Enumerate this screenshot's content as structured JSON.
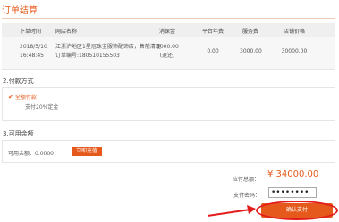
{
  "page_title": "订单结算",
  "order_table": {
    "headers": [
      "下单时间",
      "网店名称",
      "消保金",
      "平台年费",
      "服务费",
      "店铺价格"
    ],
    "row": {
      "date": "2018/5/10",
      "time": "16:48:45",
      "shop_name": "江浙沪地区1星冠珠宝服饰配饰店，售前清理",
      "order_no": "订单编号:180510155503",
      "deposit": "1000.00",
      "deposit_note": "(退还)",
      "annual_fee": "0.00",
      "service_fee": "3000.00",
      "shop_price": "30000.00"
    }
  },
  "payment": {
    "section_title": "2.付款方式",
    "option_label": "全额付款",
    "option_selected": true,
    "alt_option": "支付20%定金"
  },
  "balance": {
    "section_title": "3.可用余额",
    "label": "可用余额：0.0000",
    "recharge_button": "立即充值"
  },
  "checkout": {
    "total_label": "应付总额：",
    "total_value": "¥ 34000.00",
    "password_label": "支付密码：",
    "password_value": "••••••••",
    "confirm_button": "确认支付"
  },
  "colors": {
    "accent": "#e55a1c",
    "highlight": "#e31b1b"
  }
}
